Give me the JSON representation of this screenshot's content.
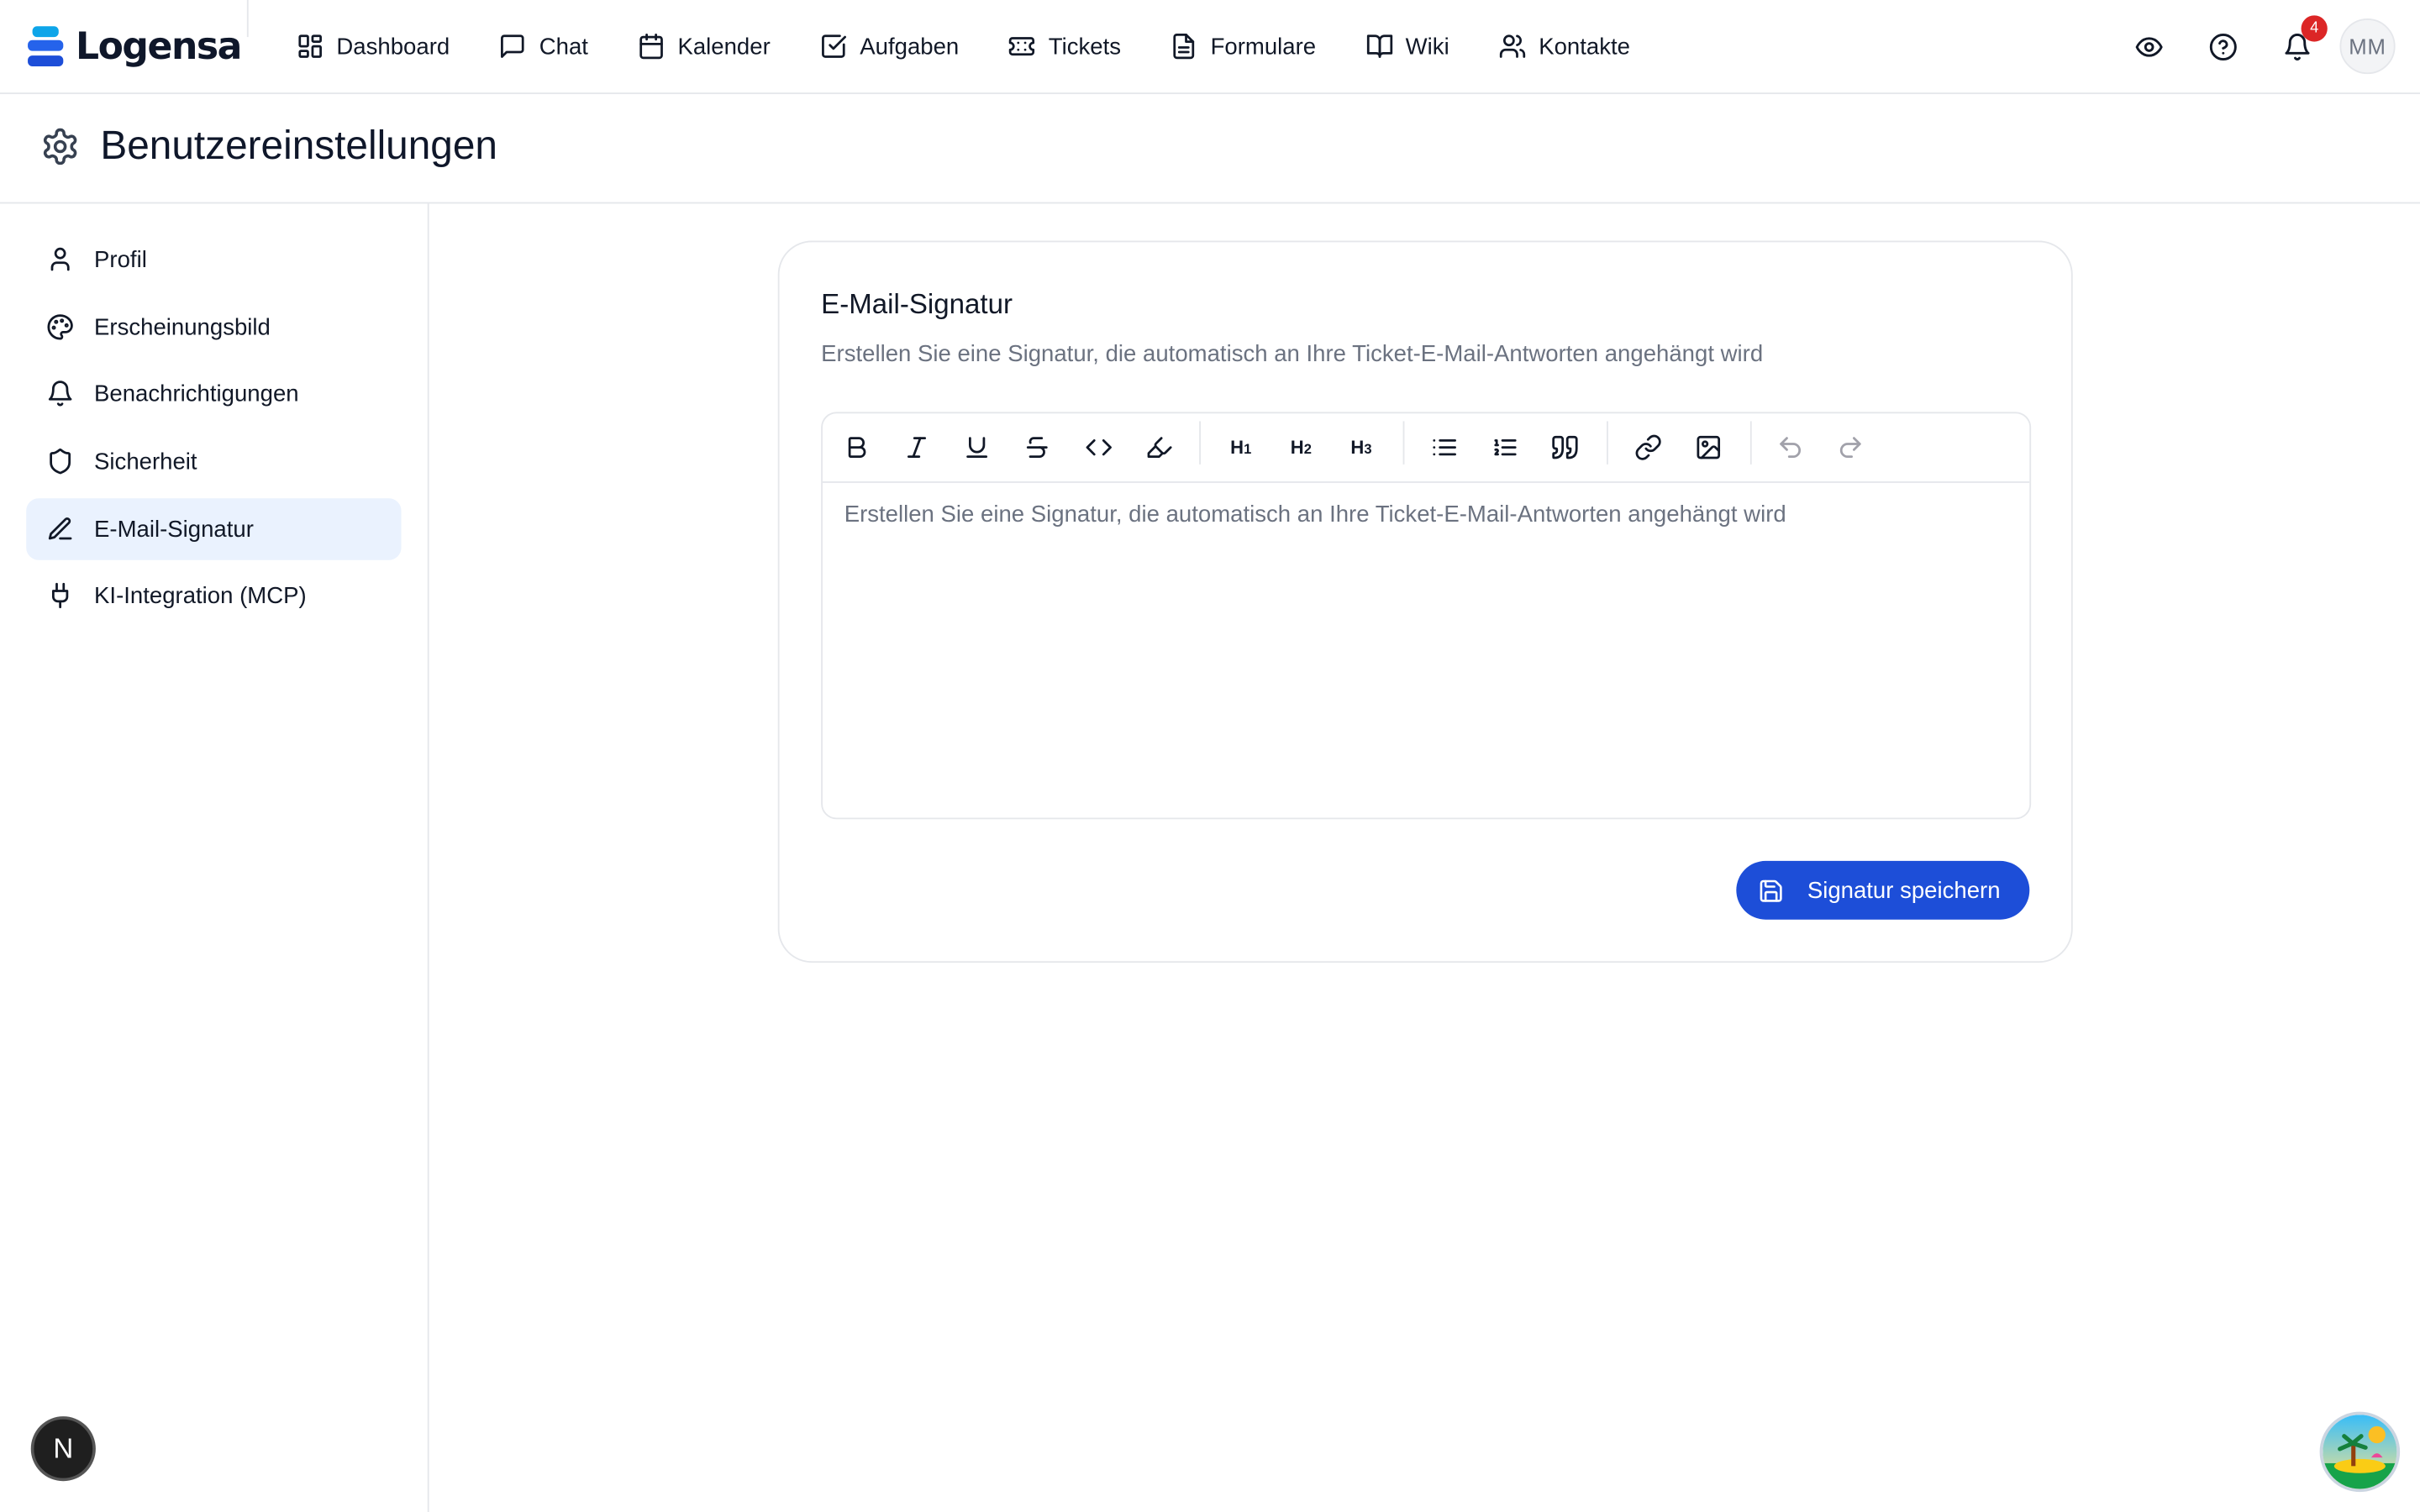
{
  "app": {
    "name": "Logensa",
    "brand_colors": [
      "#0ea5e9",
      "#2563eb",
      "#1d4ed8"
    ]
  },
  "nav": {
    "items": [
      {
        "label": "Dashboard",
        "icon": "dashboard-icon"
      },
      {
        "label": "Chat",
        "icon": "chat-icon"
      },
      {
        "label": "Kalender",
        "icon": "calendar-icon"
      },
      {
        "label": "Aufgaben",
        "icon": "checkbox-icon"
      },
      {
        "label": "Tickets",
        "icon": "ticket-icon"
      },
      {
        "label": "Formulare",
        "icon": "file-icon"
      },
      {
        "label": "Wiki",
        "icon": "book-icon"
      },
      {
        "label": "Kontakte",
        "icon": "users-icon"
      }
    ]
  },
  "topbar": {
    "notification_count": "4",
    "avatar_initials": "MM",
    "icons": [
      "eye-icon",
      "help-icon",
      "bell-icon"
    ]
  },
  "header": {
    "title": "Benutzereinstellungen",
    "icon": "gear-icon"
  },
  "sidebar": {
    "items": [
      {
        "label": "Profil",
        "icon": "user-icon",
        "active": false
      },
      {
        "label": "Erscheinungsbild",
        "icon": "palette-icon",
        "active": false
      },
      {
        "label": "Benachrichtigungen",
        "icon": "bell-icon",
        "active": false
      },
      {
        "label": "Sicherheit",
        "icon": "shield-icon",
        "active": false
      },
      {
        "label": "E-Mail-Signatur",
        "icon": "pen-icon",
        "active": true
      },
      {
        "label": "KI-Integration (MCP)",
        "icon": "plug-icon",
        "active": false
      }
    ],
    "active_bg": "#eaf2fe"
  },
  "card": {
    "title": "E-Mail-Signatur",
    "description": "Erstellen Sie eine Signatur, die automatisch an Ihre Ticket-E-Mail-Antworten angehängt wird",
    "editor": {
      "placeholder": "Erstellen Sie eine Signatur, die automatisch an Ihre Ticket-E-Mail-Antworten angehängt wird",
      "toolbar": [
        "bold-icon",
        "italic-icon",
        "underline-icon",
        "strikethrough-icon",
        "code-icon",
        "highlight-icon",
        "heading-1-icon",
        "heading-2-icon",
        "heading-3-icon",
        "bullet-list-icon",
        "ordered-list-icon",
        "quote-icon",
        "link-icon",
        "image-icon",
        "undo-icon",
        "redo-icon"
      ]
    },
    "save_label": "Signatur speichern",
    "save_color": "#1d4ed8"
  },
  "floating": {
    "nextjs_label": "N",
    "island_icon": "island-icon"
  }
}
